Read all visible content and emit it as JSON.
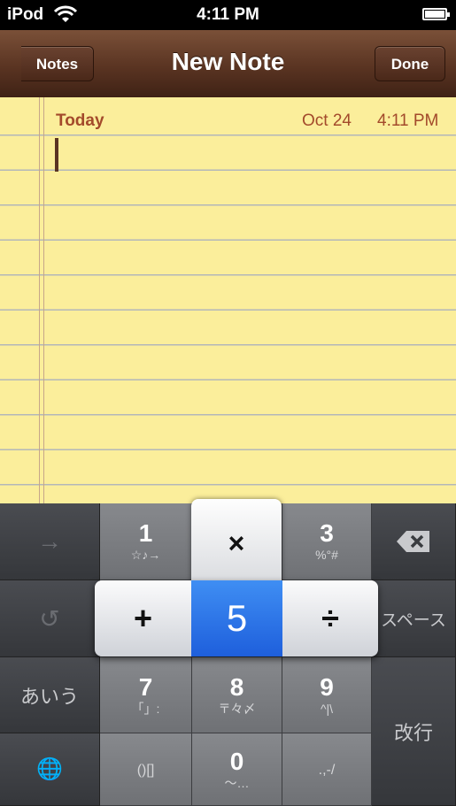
{
  "status_bar": {
    "carrier": "iPod",
    "time": "4:11 PM",
    "wifi_icon": "wifi-icon",
    "battery_icon": "battery-icon"
  },
  "nav": {
    "back_label": "Notes",
    "title": "New Note",
    "done_label": "Done"
  },
  "note": {
    "day": "Today",
    "date": "Oct 24",
    "time": "4:11 PM"
  },
  "keyboard": {
    "rows": [
      {
        "keys": [
          {
            "name": "arrow-right",
            "main": "→"
          },
          {
            "name": "1",
            "main": "1",
            "sub": "☆♪→"
          },
          {
            "name": "2-times",
            "main": "×"
          },
          {
            "name": "3",
            "main": "3",
            "sub": "%°#"
          },
          {
            "name": "delete",
            "main": "⌫"
          }
        ]
      },
      {
        "keys": [
          {
            "name": "undo",
            "main": "↺"
          },
          {
            "name": "4-plus",
            "main": "+"
          },
          {
            "name": "5",
            "main": "5"
          },
          {
            "name": "6-divide",
            "main": "÷"
          },
          {
            "name": "space",
            "main": "スペース"
          }
        ]
      },
      {
        "keys": [
          {
            "name": "kana",
            "main": "あいう"
          },
          {
            "name": "7",
            "main": "7",
            "sub": "「」:"
          },
          {
            "name": "8",
            "main": "8",
            "sub": "〒々〆"
          },
          {
            "name": "9",
            "main": "9",
            "sub": "^|\\"
          }
        ]
      },
      {
        "keys": [
          {
            "name": "globe",
            "main": "🌐"
          },
          {
            "name": "brackets",
            "main": "()[]"
          },
          {
            "name": "0",
            "main": "0",
            "sub": "〜…"
          },
          {
            "name": "punct",
            "main": ".,-/"
          }
        ]
      }
    ],
    "return_label": "改行",
    "popup": {
      "top": "×",
      "left": "+",
      "center": "5",
      "right": "÷"
    }
  },
  "colors": {
    "paper": "#fbee9b",
    "nav": "#5a3422",
    "accent_text": "#a34a2b",
    "highlight": "#2a6fe6"
  }
}
